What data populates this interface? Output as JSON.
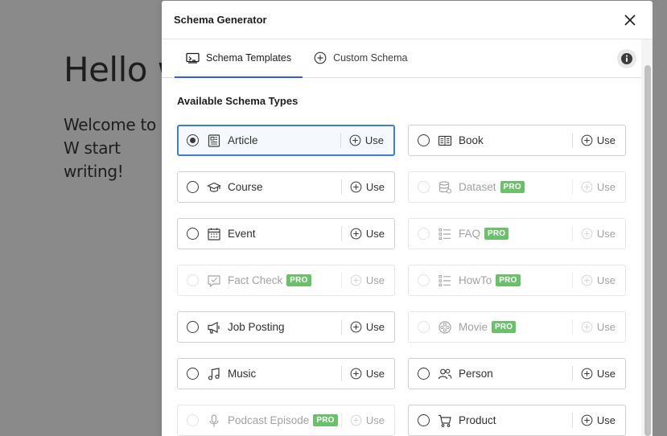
{
  "background": {
    "title": "Hello w",
    "text": "Welcome to W start writing!"
  },
  "modal": {
    "title": "Schema Generator",
    "close_icon": "close-x",
    "tabs": [
      {
        "label": "Schema Templates",
        "icon": "template-icon",
        "active": true
      },
      {
        "label": "Custom Schema",
        "icon": "plus-circle-icon",
        "active": false
      }
    ],
    "info_icon": "info-icon",
    "section_title": "Available Schema Types",
    "use_label": "Use",
    "pro_label": "PRO",
    "types": [
      {
        "label": "Article",
        "icon": "article",
        "selected": true,
        "pro": false
      },
      {
        "label": "Book",
        "icon": "book",
        "selected": false,
        "pro": false
      },
      {
        "label": "Course",
        "icon": "course",
        "selected": false,
        "pro": false
      },
      {
        "label": "Dataset",
        "icon": "dataset",
        "selected": false,
        "pro": true
      },
      {
        "label": "Event",
        "icon": "event",
        "selected": false,
        "pro": false
      },
      {
        "label": "FAQ",
        "icon": "list",
        "selected": false,
        "pro": true
      },
      {
        "label": "Fact Check",
        "icon": "factcheck",
        "selected": false,
        "pro": true
      },
      {
        "label": "HowTo",
        "icon": "list",
        "selected": false,
        "pro": true
      },
      {
        "label": "Job Posting",
        "icon": "megaphone",
        "selected": false,
        "pro": false
      },
      {
        "label": "Movie",
        "icon": "film",
        "selected": false,
        "pro": true
      },
      {
        "label": "Music",
        "icon": "music",
        "selected": false,
        "pro": false
      },
      {
        "label": "Person",
        "icon": "person",
        "selected": false,
        "pro": false
      },
      {
        "label": "Podcast Episode",
        "icon": "mic",
        "selected": false,
        "pro": true
      },
      {
        "label": "Product",
        "icon": "cart",
        "selected": false,
        "pro": false
      }
    ]
  },
  "colors": {
    "accent": "#3858e9",
    "selected_border": "#3d7fc4",
    "pro_badge": "#5cb85c"
  }
}
